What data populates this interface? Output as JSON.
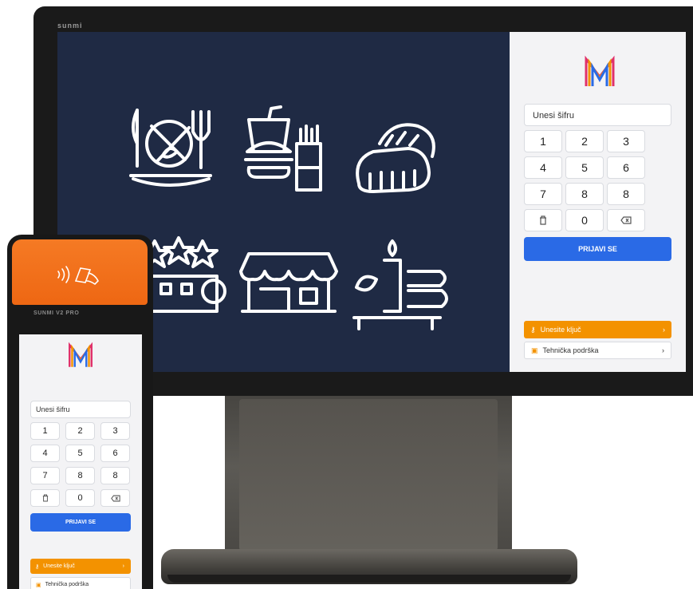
{
  "device": {
    "brand_monitor": "sunmi",
    "brand_handheld": "SUNMI V2 PRO"
  },
  "login": {
    "pin_placeholder": "Unesi šifru",
    "keypad": [
      "1",
      "2",
      "3",
      "4",
      "5",
      "6",
      "7",
      "8",
      "8",
      "",
      "0",
      ""
    ],
    "keypad_handheld": [
      "1",
      "2",
      "3",
      "4",
      "5",
      "6",
      "7",
      "8",
      "8",
      "",
      "0",
      ""
    ],
    "special_keys": {
      "clear": "trash-icon",
      "backspace": "backspace-icon"
    },
    "submit_label": "PRIJAVI SE",
    "enter_key_label": "Unesite ključ",
    "support_label": "Tehnička podrška"
  },
  "categories": [
    {
      "icon": "restaurant-icon"
    },
    {
      "icon": "fast-food-icon"
    },
    {
      "icon": "bakery-icon"
    },
    {
      "icon": "hotel-icon"
    },
    {
      "icon": "shop-icon"
    },
    {
      "icon": "spa-icon"
    }
  ],
  "colors": {
    "primary": "#2a6ae6",
    "accent": "#f39200",
    "art_bg": "#1f2a44",
    "handheld_shell": "#f07019"
  }
}
